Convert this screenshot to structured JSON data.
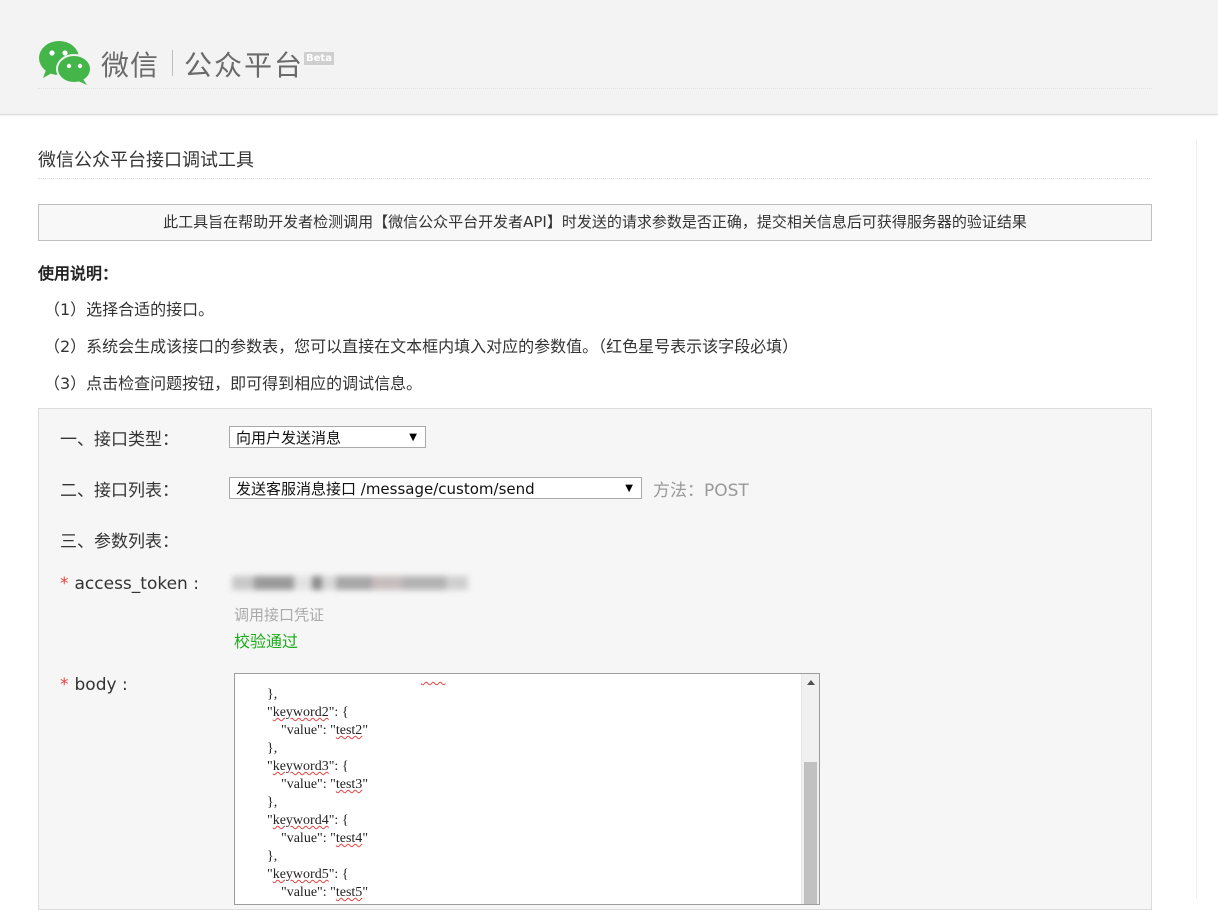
{
  "header": {
    "brand_wechat": "微信",
    "brand_platform": "公众平台",
    "beta": "Beta",
    "logo_icon": "wechat-logo-icon",
    "logo_color": "#44b549"
  },
  "page": {
    "title": "微信公众平台接口调试工具",
    "notice": "此工具旨在帮助开发者检测调用【微信公众平台开发者API】时发送的请求参数是否正确，提交相关信息后可获得服务器的验证结果",
    "usage_title": "使用说明：",
    "usage": [
      "（1）选择合适的接口。",
      "（2）系统会生成该接口的参数表，您可以直接在文本框内填入对应的参数值。（红色星号表示该字段必填）",
      "（3）点击检查问题按钮，即可得到相应的调试信息。"
    ]
  },
  "form": {
    "type_label": "一、接口类型：",
    "type_value": "向用户发送消息",
    "list_label": "二、接口列表：",
    "list_value": "发送客服消息接口 /message/custom/send",
    "method": "方法：POST",
    "params_label": "三、参数列表：",
    "required_mark": "*",
    "token_label": "access_token :",
    "token_hint": "调用接口凭证",
    "token_status": "校验通过",
    "token_status_color": "#1aad19",
    "body_label": "body :",
    "body_lines": [
      "        },",
      "        \"keyword2\": {",
      "            \"value\": \"test2\"",
      "        },",
      "        \"keyword3\": {",
      "            \"value\": \"test3\"",
      "        },",
      "        \"keyword4\": {",
      "            \"value\": \"test4\"",
      "        },",
      "        \"keyword5\": {",
      "            \"value\": \"test5\"",
      "        }"
    ]
  }
}
